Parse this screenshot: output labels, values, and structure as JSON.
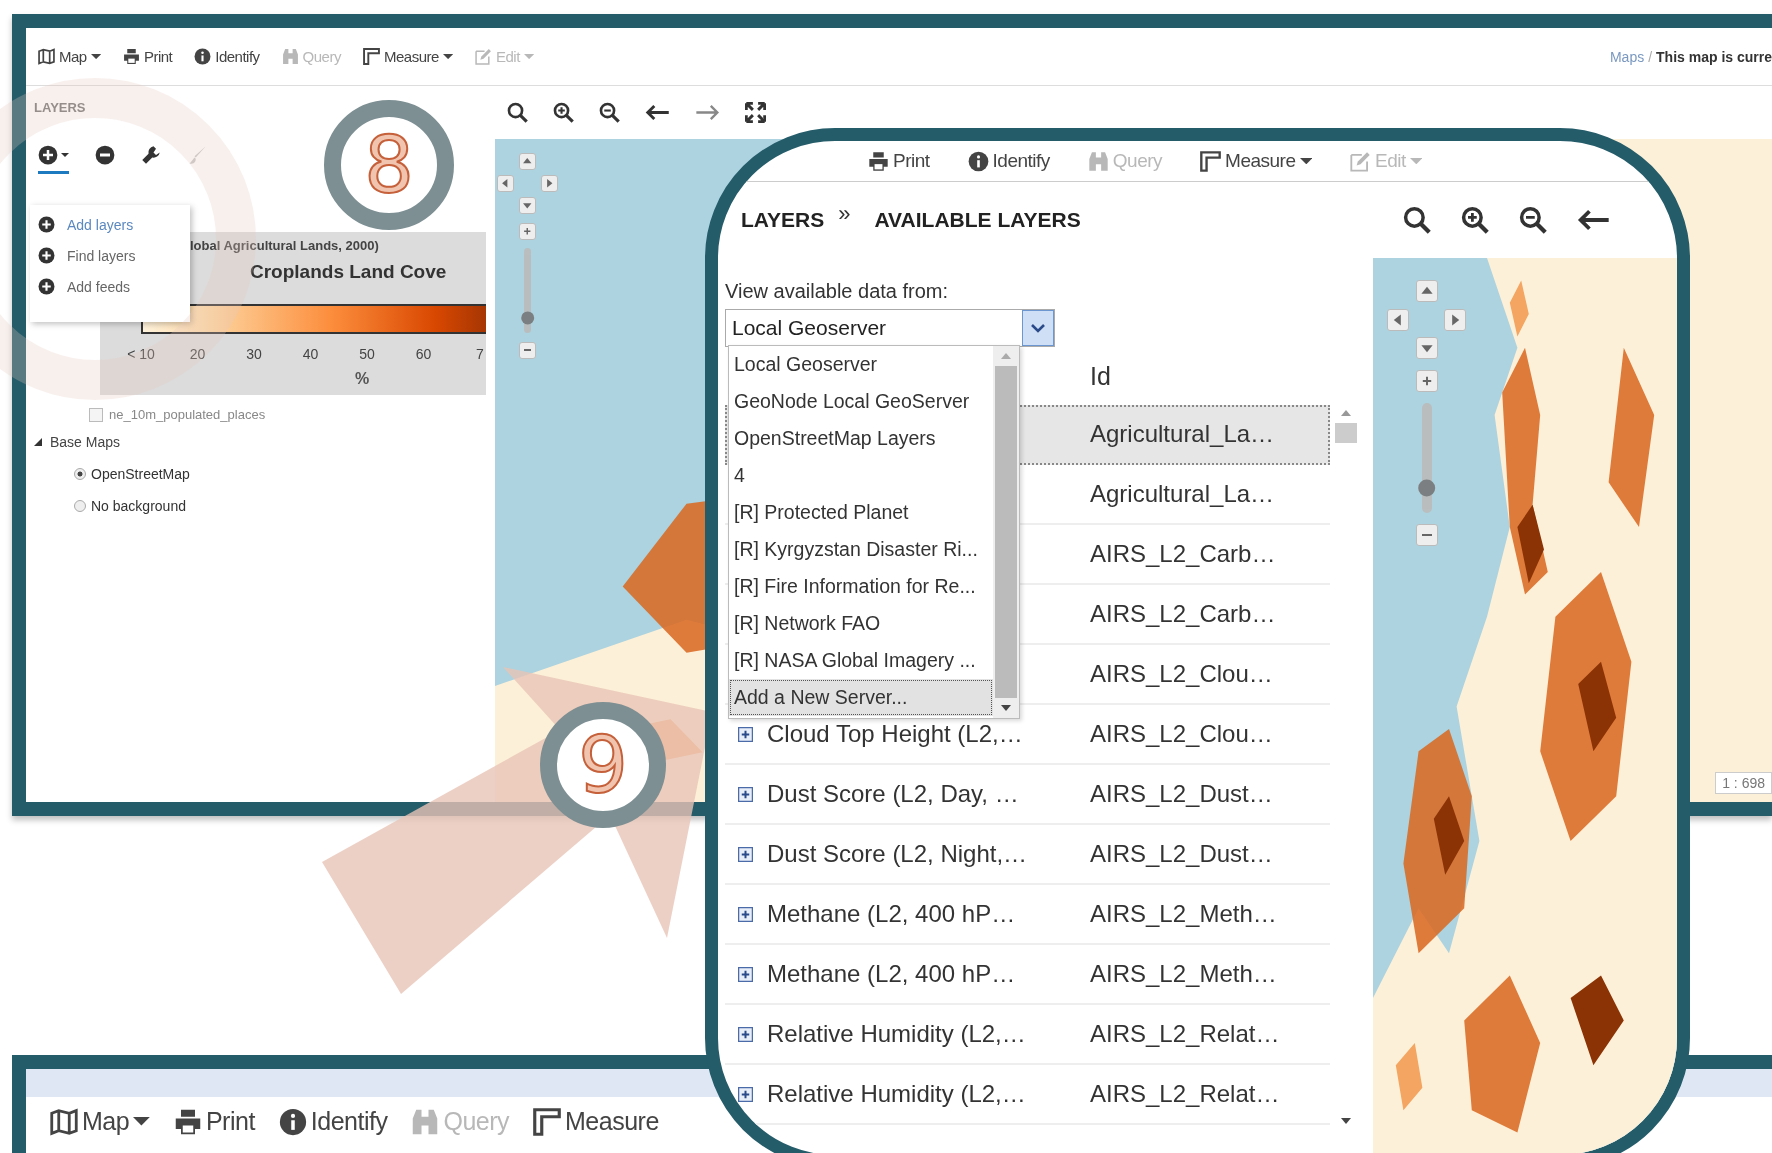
{
  "back_window": {
    "toolbar": [
      {
        "label": "Map",
        "kind": "map",
        "dropdown": true,
        "disabled": false
      },
      {
        "label": "Print",
        "kind": "print",
        "dropdown": false,
        "disabled": false
      },
      {
        "label": "Identify",
        "kind": "identify",
        "dropdown": false,
        "disabled": false
      },
      {
        "label": "Query",
        "kind": "query",
        "dropdown": false,
        "disabled": true
      },
      {
        "label": "Measure",
        "kind": "measure",
        "dropdown": true,
        "disabled": false
      },
      {
        "label": "Edit",
        "kind": "edit",
        "dropdown": true,
        "disabled": true
      }
    ],
    "breadcrumb": {
      "link": "Maps",
      "separator": "/",
      "current": "This map is curre"
    },
    "layers_panel": {
      "title": "LAYERS",
      "tools": [
        {
          "kind": "add",
          "selected": true,
          "disabled": false
        },
        {
          "kind": "remove",
          "selected": false,
          "disabled": false
        },
        {
          "kind": "settings",
          "selected": false,
          "disabled": false
        },
        {
          "kind": "style",
          "selected": false,
          "disabled": true
        }
      ],
      "add_menu": [
        {
          "label": "Add layers",
          "selected": true
        },
        {
          "label": "Find layers",
          "selected": false
        },
        {
          "label": "Add feeds",
          "selected": false
        }
      ],
      "legend": {
        "subtitle": "lobal Agricultural Lands, 2000)",
        "title": "Croplands Land Cove",
        "ticks": [
          "< 10",
          "20",
          "30",
          "40",
          "50",
          "60",
          "7"
        ],
        "unit": "%"
      },
      "layers": [
        {
          "label": "ne_10m_populated_places",
          "checked": false
        }
      ],
      "base_maps": {
        "label": "Base Maps",
        "expanded": true,
        "options": [
          {
            "label": "OpenStreetMap",
            "selected": true
          },
          {
            "label": "No background",
            "selected": false
          }
        ]
      }
    },
    "map": {
      "zoom_slider": {
        "level": 0.1
      },
      "scale": "1 : 698"
    }
  },
  "step_badges": [
    "8",
    "9"
  ],
  "zoom_view": {
    "toolbar": [
      {
        "label": "Print",
        "kind": "print",
        "dropdown": false,
        "disabled": false
      },
      {
        "label": "Identify",
        "kind": "identify",
        "dropdown": false,
        "disabled": false
      },
      {
        "label": "Query",
        "kind": "query",
        "dropdown": false,
        "disabled": true
      },
      {
        "label": "Measure",
        "kind": "measure",
        "dropdown": true,
        "disabled": false
      },
      {
        "label": "Edit",
        "kind": "edit",
        "dropdown": true,
        "disabled": true
      }
    ],
    "breadcrumb": {
      "parent": "LAYERS",
      "separator": "»",
      "current": "AVAILABLE LAYERS"
    },
    "source_label": "View available data from:",
    "source_select": {
      "value": "Local Geoserver",
      "expanded": true,
      "options": [
        {
          "label": "Local Geoserver",
          "highlighted": false
        },
        {
          "label": "GeoNode Local GeoServer",
          "highlighted": false
        },
        {
          "label": "OpenStreetMap Layers",
          "highlighted": false
        },
        {
          "label": "4",
          "highlighted": false
        },
        {
          "label": "[R] Protected Planet",
          "highlighted": false
        },
        {
          "label": "[R] Kyrgyzstan Disaster Ri...",
          "highlighted": false
        },
        {
          "label": "[R] Fire Information for Re...",
          "highlighted": false
        },
        {
          "label": "[R] Network FAO",
          "highlighted": false
        },
        {
          "label": "[R] NASA Global Imagery ...",
          "highlighted": false
        },
        {
          "label": "Add a New Server...",
          "highlighted": true
        }
      ]
    },
    "table": {
      "columns": [
        {
          "label": "Id"
        }
      ],
      "rows": [
        {
          "id": "Agricultural_La…",
          "selected": true
        },
        {
          "id": "Agricultural_La…",
          "selected": false
        },
        {
          "id": "AIRS_L2_Carb…",
          "selected": false
        },
        {
          "id": "AIRS_L2_Carb…",
          "selected": false
        },
        {
          "id": "AIRS_L2_Clou…",
          "selected": false
        },
        {
          "title": "Cloud Top Height (L2,…",
          "id": "AIRS_L2_Clou…",
          "selected": false
        },
        {
          "title": "Dust Score (L2, Day, …",
          "id": "AIRS_L2_Dust…",
          "selected": false
        },
        {
          "title": "Dust Score (L2, Night,…",
          "id": "AIRS_L2_Dust…",
          "selected": false
        },
        {
          "title": "Methane (L2, 400 hP…",
          "id": "AIRS_L2_Meth…",
          "selected": false
        },
        {
          "title": "Methane (L2, 400 hP…",
          "id": "AIRS_L2_Meth…",
          "selected": false
        },
        {
          "title": "Relative Humidity (L2,…",
          "id": "AIRS_L2_Relat…",
          "selected": false
        },
        {
          "title": "Relative Humidity (L2,…",
          "id": "AIRS_L2_Relat…",
          "selected": false
        }
      ]
    },
    "map": {
      "zoom_slider": {
        "level": 0.15
      }
    }
  },
  "bottom_window": {
    "toolbar": [
      {
        "label": "Map",
        "kind": "map",
        "dropdown": true,
        "disabled": false
      },
      {
        "label": "Print",
        "kind": "print",
        "dropdown": false,
        "disabled": false
      },
      {
        "label": "Identify",
        "kind": "identify",
        "dropdown": false,
        "disabled": false
      },
      {
        "label": "Query",
        "kind": "query",
        "dropdown": false,
        "disabled": true
      },
      {
        "label": "Measure",
        "kind": "measure",
        "dropdown": false,
        "disabled": false
      }
    ]
  }
}
